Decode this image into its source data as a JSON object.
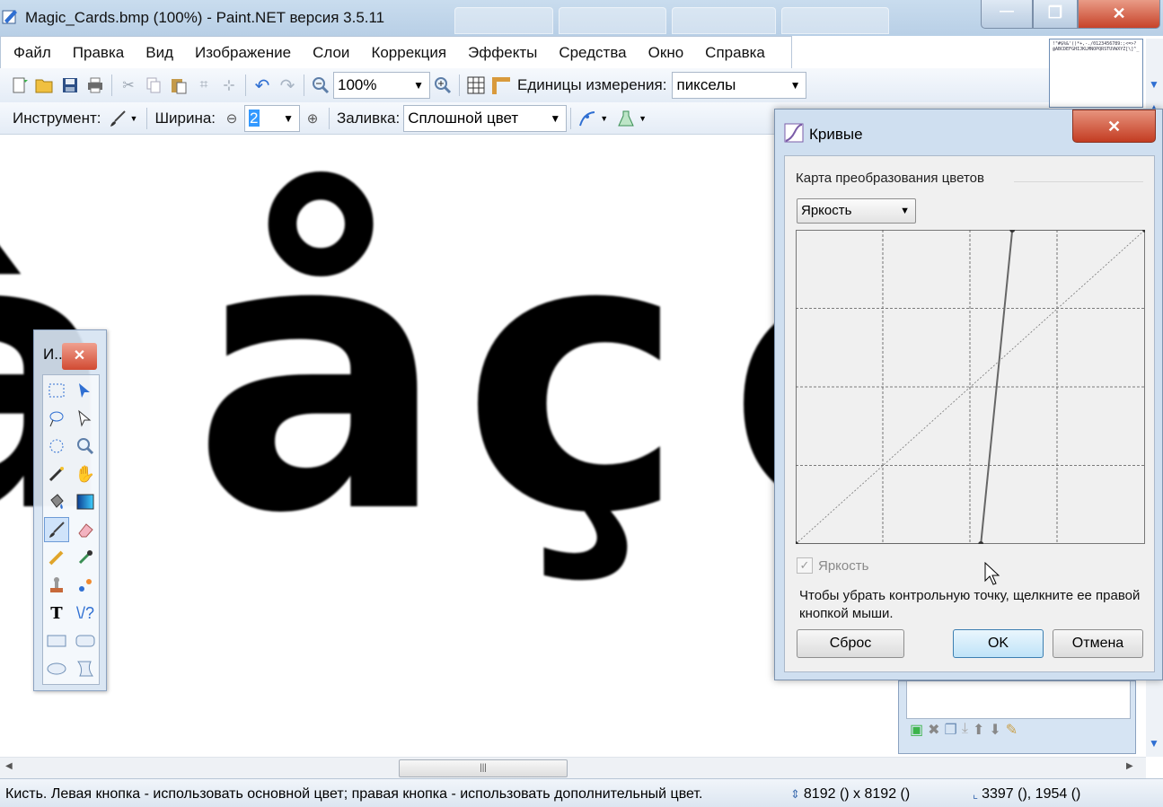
{
  "window": {
    "title": "Magic_Cards.bmp (100%) - Paint.NET версия 3.5.11",
    "min_glyph": "—",
    "max_glyph": "❐",
    "close_glyph": "✕"
  },
  "menu": [
    "Файл",
    "Правка",
    "Вид",
    "Изображение",
    "Слои",
    "Коррекция",
    "Эффекты",
    "Средства",
    "Окно",
    "Справка"
  ],
  "toolbar1": {
    "zoom_value": "100%",
    "units_label": "Единицы измерения:",
    "units_value": "пикселы"
  },
  "toolbar2": {
    "tool_label": "Инструмент:",
    "width_label": "Ширина:",
    "width_value": "2",
    "fill_label": "Заливка:",
    "fill_value": "Сплошной цвет"
  },
  "canvas": {
    "glyphs": [
      "à",
      "å",
      "ç",
      "e"
    ]
  },
  "tools_window": {
    "title": "И...",
    "close": "✕"
  },
  "curves_dialog": {
    "title": "Кривые",
    "close": "✕",
    "group_label": "Карта преобразования цветов",
    "mode_value": "Яркость",
    "checkbox_label": "Яркость",
    "checkbox_checked": true,
    "hint": "Чтобы убрать контрольную точку, щелкните ее правой кнопкой мыши.",
    "reset_label": "Сброс",
    "ok_label": "OK",
    "cancel_label": "Отмена",
    "curve_points": [
      [
        0,
        0
      ],
      [
        0.53,
        0
      ],
      [
        0.62,
        1
      ],
      [
        1,
        1
      ]
    ]
  },
  "thumbnail": {
    "text": "!\"#$%&'()*+,-./0123456789:;<=>?@ABCDEFGHIJKLMNOPQRSTUVWXYZ[\\]^_`abcdefghijklmnopqrstuvwxyz{|}~ÀÁÂÃÄÅÆÇÈÉÊËÌÍÎÏÐÑÒÓÔÕÖ×ØÙÚÛÜÝÞßàáâãäåæçèéêëìíîïðñòóôõö÷øùúûüýþÿ"
  },
  "status": {
    "text": "Кисть. Левая кнопка - использовать основной цвет; правая кнопка - использовать дополнительный цвет.",
    "size": "8192 () x 8192 ()",
    "position": "3397 (), 1954 ()"
  },
  "icons": {
    "new": "new-image-icon",
    "open": "open-icon",
    "save": "save-icon",
    "print": "print-icon",
    "cut": "cut-icon",
    "copy": "copy-icon",
    "paste": "paste-icon",
    "crop": "crop-icon",
    "deselect": "deselect-icon",
    "undo": "undo-icon",
    "redo": "redo-icon",
    "zoom_out": "zoom-out-icon",
    "zoom_in": "zoom-in-icon",
    "grid": "grid-icon",
    "ruler": "ruler-icon"
  }
}
